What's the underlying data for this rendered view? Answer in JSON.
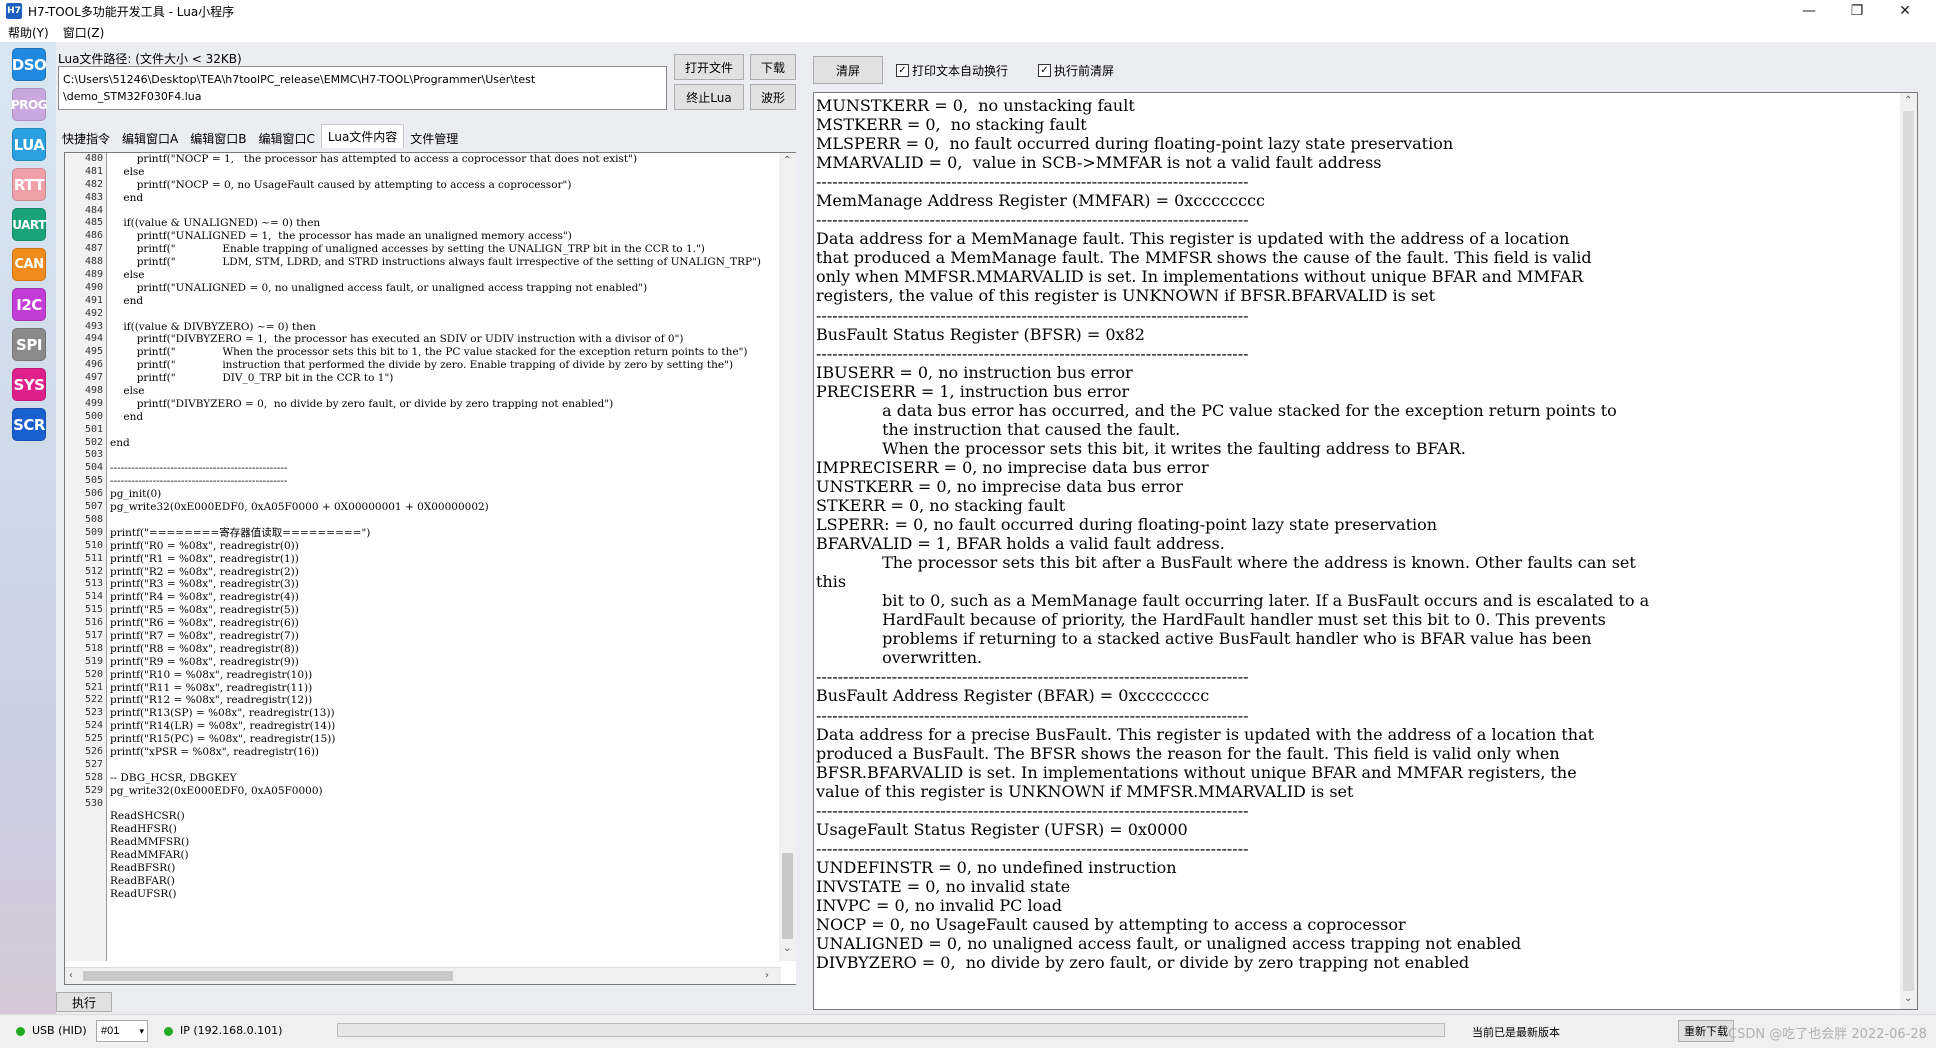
{
  "window": {
    "title": "H7-TOOL多功能开发工具 - Lua小程序",
    "icon_text": "H7",
    "minimize": "—",
    "maximize": "❐",
    "close": "✕"
  },
  "menu": [
    "帮助(Y)",
    "窗口(Z)"
  ],
  "sidebar": [
    {
      "label": "DSO",
      "color": "#1f8ae0"
    },
    {
      "label": "PROG",
      "color": "#c9a8e0"
    },
    {
      "label": "LUA",
      "color": "#2aa0e0"
    },
    {
      "label": "RTT",
      "color": "#f0a0a8"
    },
    {
      "label": "UART",
      "color": "#1aa37a"
    },
    {
      "label": "CAN",
      "color": "#f08a1a"
    },
    {
      "label": "I2C",
      "color": "#c23cd6"
    },
    {
      "label": "SPI",
      "color": "#8a8a8a"
    },
    {
      "label": "SYS",
      "color": "#e0208a"
    },
    {
      "label": "SCR",
      "color": "#1a5fd0"
    }
  ],
  "lua": {
    "path_label": "Lua文件路径: (文件大小 < 32KB)",
    "path_value": "C:\\Users\\51246\\Desktop\\TEA\\h7toolPC_release\\EMMC\\H7-TOOL\\Programmer\\User\\test\n\\demo_STM32F030F4.lua",
    "buttons": {
      "open": "打开文件",
      "download": "下载",
      "stop": "终止Lua",
      "wave": "波形",
      "run": "执行"
    },
    "tabs": [
      "快捷指令",
      "编辑窗口A",
      "编辑窗口B",
      "编辑窗口C",
      "Lua文件内容",
      "文件管理"
    ],
    "active_tab": 4
  },
  "editor": {
    "line_numbers": [
      "480",
      "481",
      "482",
      "483",
      "484",
      "485",
      "486",
      "487",
      "488",
      "489",
      "490",
      "491",
      "492",
      "493",
      "494",
      "495",
      "496",
      "497",
      "498",
      "499",
      "500",
      "501",
      "502",
      "503",
      "504",
      "505",
      "506",
      "507",
      "508",
      "509",
      "510",
      "511",
      "512",
      "513",
      "514",
      "515",
      "516",
      "517",
      "518",
      "519",
      "520",
      "521",
      "522",
      "523",
      "524",
      "525",
      "526",
      "527",
      "528",
      "529",
      "530"
    ],
    "lines": [
      "        printf(\"NOCP = 1,   the processor has attempted to access a coprocessor that does not exist\")",
      "    else",
      "        printf(\"NOCP = 0, no UsageFault caused by attempting to access a coprocessor\")",
      "    end",
      "",
      "    if((value & UNALIGNED) ~= 0) then",
      "        printf(\"UNALIGNED = 1,  the processor has made an unaligned memory access\")",
      "        printf(\"              Enable trapping of unaligned accesses by setting the UNALIGN_TRP bit in the CCR to 1.\")",
      "        printf(\"              LDM, STM, LDRD, and STRD instructions always fault irrespective of the setting of UNALIGN_TRP\")",
      "    else",
      "        printf(\"UNALIGNED = 0, no unaligned access fault, or unaligned access trapping not enabled\")",
      "    end",
      "",
      "    if((value & DIVBYZERO) ~= 0) then",
      "        printf(\"DIVBYZERO = 1,  the processor has executed an SDIV or UDIV instruction with a divisor of 0\")",
      "        printf(\"              When the processor sets this bit to 1, the PC value stacked for the exception return points to the\")",
      "        printf(\"              instruction that performed the divide by zero. Enable trapping of divide by zero by setting the\")",
      "        printf(\"              DIV_0_TRP bit in the CCR to 1\")",
      "    else",
      "        printf(\"DIVBYZERO = 0,  no divide by zero fault, or divide by zero trapping not enabled\")",
      "    end",
      "",
      "end",
      "",
      "--------------------------------------------------",
      "--------------------------------------------------",
      "pg_init(0)",
      "pg_write32(0xE000EDF0, 0xA05F0000 + 0X00000001 + 0X00000002)",
      "",
      "printf(\"========寄存器值读取=========\")",
      "printf(\"R0 = %08x\", readregistr(0))",
      "printf(\"R1 = %08x\", readregistr(1))",
      "printf(\"R2 = %08x\", readregistr(2))",
      "printf(\"R3 = %08x\", readregistr(3))",
      "printf(\"R4 = %08x\", readregistr(4))",
      "printf(\"R5 = %08x\", readregistr(5))",
      "printf(\"R6 = %08x\", readregistr(6))",
      "printf(\"R7 = %08x\", readregistr(7))",
      "printf(\"R8 = %08x\", readregistr(8))",
      "printf(\"R9 = %08x\", readregistr(9))",
      "printf(\"R10 = %08x\", readregistr(10))",
      "printf(\"R11 = %08x\", readregistr(11))",
      "printf(\"R12 = %08x\", readregistr(12))",
      "printf(\"R13(SP) = %08x\", readregistr(13))",
      "printf(\"R14(LR) = %08x\", readregistr(14))",
      "printf(\"R15(PC) = %08x\", readregistr(15))",
      "printf(\"xPSR = %08x\", readregistr(16))",
      "",
      "-- DBG_HCSR, DBGKEY",
      "pg_write32(0xE000EDF0, 0xA05F0000)",
      "",
      "ReadSHCSR()",
      "ReadHFSR()",
      "ReadMMFSR()",
      "ReadMMFAR()",
      "ReadBFSR()",
      "ReadBFAR()",
      "ReadUFSR()"
    ]
  },
  "output_panel": {
    "clear_button": "清屏",
    "checkbox_wrap": {
      "label": "打印文本自动换行",
      "checked": true
    },
    "checkbox_clear": {
      "label": "执行前清屏",
      "checked": true
    },
    "lines": [
      "MUNSTKERR = 0,  no unstacking fault",
      "MSTKERR = 0,  no stacking fault",
      "MLSPERR = 0,  no fault occurred during floating-point lazy state preservation",
      "MMARVALID = 0,  value in SCB->MMFAR is not a valid fault address",
      "--------------------------------------------------------------------------------",
      "MemManage Address Register (MMFAR) = 0xcccccccc",
      "--------------------------------------------------------------------------------",
      "Data address for a MemManage fault. This register is updated with the address of a location",
      "that produced a MemManage fault. The MMFSR shows the cause of the fault. This field is valid",
      "only when MMFSR.MMARVALID is set. In implementations without unique BFAR and MMFAR",
      "registers, the value of this register is UNKNOWN if BFSR.BFARVALID is set",
      "--------------------------------------------------------------------------------",
      "BusFault Status Register (BFSR) = 0x82",
      "--------------------------------------------------------------------------------",
      "IBUSERR = 0, no instruction bus error",
      "PRECISERR = 1, instruction bus error",
      "             a data bus error has occurred, and the PC value stacked for the exception return points to",
      "             the instruction that caused the fault.",
      "             When the processor sets this bit, it writes the faulting address to BFAR.",
      "IMPRECISERR = 0, no imprecise data bus error",
      "UNSTKERR = 0, no imprecise data bus error",
      "STKERR = 0, no stacking fault",
      "LSPERR: = 0, no fault occurred during floating-point lazy state preservation",
      "BFARVALID = 1, BFAR holds a valid fault address.",
      "             The processor sets this bit after a BusFault where the address is known. Other faults can set",
      "this",
      "             bit to 0, such as a MemManage fault occurring later. If a BusFault occurs and is escalated to a",
      "             HardFault because of priority, the HardFault handler must set this bit to 0. This prevents",
      "             problems if returning to a stacked active BusFault handler who is BFAR value has been",
      "             overwritten.",
      "--------------------------------------------------------------------------------",
      "BusFault Address Register (BFAR) = 0xcccccccc",
      "--------------------------------------------------------------------------------",
      "Data address for a precise BusFault. This register is updated with the address of a location that",
      "produced a BusFault. The BFSR shows the reason for the fault. This field is valid only when",
      "BFSR.BFARVALID is set. In implementations without unique BFAR and MMFAR registers, the",
      "value of this register is UNKNOWN if MMFSR.MMARVALID is set",
      "--------------------------------------------------------------------------------",
      "UsageFault Status Register (UFSR) = 0x0000",
      "--------------------------------------------------------------------------------",
      "UNDEFINSTR = 0, no undefined instruction",
      "INVSTATE = 0, no invalid state",
      "INVPC = 0, no invalid PC load",
      "NOCP = 0, no UsageFault caused by attempting to access a coprocessor",
      "UNALIGNED = 0, no unaligned access fault, or unaligned access trapping not enabled",
      "DIVBYZERO = 0,  no divide by zero fault, or divide by zero trapping not enabled"
    ]
  },
  "status": {
    "connection": "USB (HID)",
    "device": "#01",
    "ip": "IP (192.168.0.101)",
    "version_msg": "当前已是最新版本",
    "redownload": "重新下载",
    "watermark": "CSDN @吃了也会胖 2022-06-28"
  }
}
